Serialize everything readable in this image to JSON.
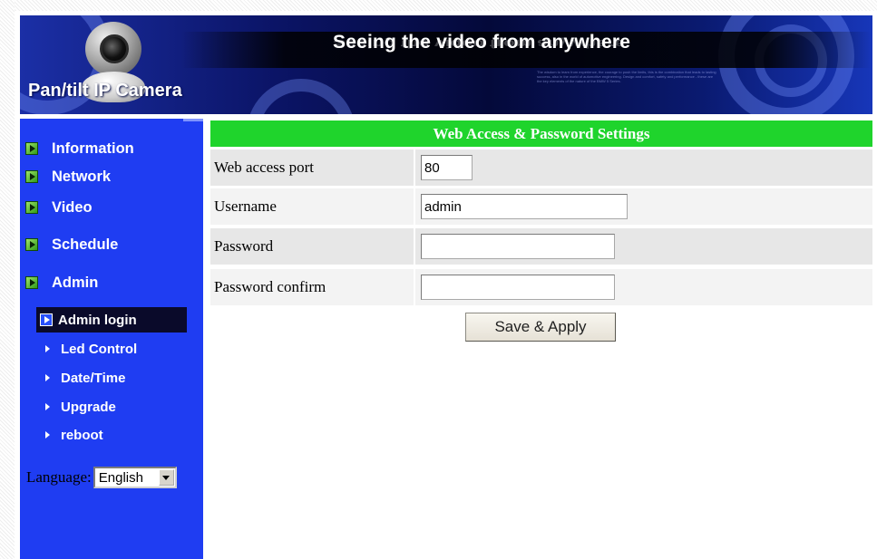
{
  "header": {
    "brand": "Pan/tilt IP Camera",
    "slogan": "Seeing the video from anywhere",
    "fine_print": "The wisdom to learn from experience, the courage to push the limits, this is the combination that leads to lasting success, also in the world of automotive engineering. Design and comfort, safety and performance - these are the key elements of the nature of the BMW 5 Series."
  },
  "sidebar": {
    "items": [
      {
        "label": "Information",
        "icon": "arrow-bullet-icon"
      },
      {
        "label": "Network",
        "icon": "arrow-bullet-icon"
      },
      {
        "label": "Video",
        "icon": "arrow-bullet-icon"
      },
      {
        "label": "Schedule",
        "icon": "arrow-bullet-icon"
      },
      {
        "label": "Admin",
        "icon": "arrow-bullet-icon"
      }
    ],
    "admin_subitems": [
      {
        "label": "Admin login",
        "active": true
      },
      {
        "label": "Led Control"
      },
      {
        "label": "Date/Time"
      },
      {
        "label": "Upgrade"
      },
      {
        "label": "reboot"
      }
    ],
    "language": {
      "label": "Language:",
      "selected": "English"
    }
  },
  "panel": {
    "title": "Web Access & Password Settings",
    "rows": [
      {
        "label": "Web access port",
        "value": "80"
      },
      {
        "label": "Username",
        "value": "admin"
      },
      {
        "label": "Password",
        "value": ""
      },
      {
        "label": "Password confirm",
        "value": ""
      }
    ],
    "save_label": "Save & Apply"
  },
  "colors": {
    "sidebar_bg": "#1f3df2",
    "header_green": "#1fd42c",
    "row_bg": "#e7e7e7",
    "banner_dark": "#04093a"
  }
}
